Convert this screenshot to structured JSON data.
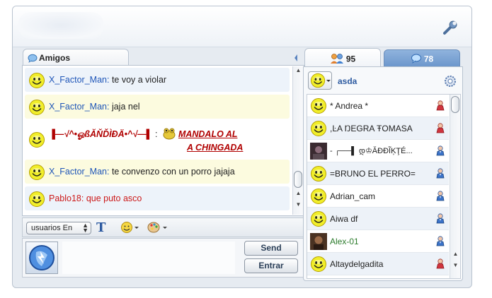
{
  "left": {
    "tab_label": "Amigos",
    "messages": [
      {
        "user": "X_Factor_Man",
        "sep": ": ",
        "text": "te voy a violar"
      },
      {
        "user": "X_Factor_Man",
        "sep": ": ",
        "text": "jaja nel"
      },
      {
        "user": "▐—√^•ஓßĂŇĎÌĐÄ•^√—▌",
        "sep": " : ",
        "text_line1": "MANDALO AL",
        "text_line2": "A CHINGADA"
      },
      {
        "user": "X_Factor_Man",
        "sep": ": ",
        "text": "te convenzo con un porro jajaja"
      },
      {
        "user": "Pablo18",
        "sep": ": ",
        "text": "que puto asco"
      }
    ],
    "toolbar": {
      "users_select": "usuarios En",
      "font_icon": "T"
    },
    "compose": {
      "send_label": "Send",
      "enter_label": "Entrar",
      "input_value": ""
    }
  },
  "right": {
    "users_tab_count": "95",
    "rooms_tab_count": "78",
    "my_name": "asda",
    "users": [
      {
        "name": "* Andrea *",
        "gender": "female"
      },
      {
        "name": ",ĿA ŊEGRA ŦOMASA",
        "gender": "female"
      },
      {
        "name": "-         ┌──▌ დ♔ĂĐĐĨĶŢÉ...",
        "gender": "male"
      },
      {
        "name": "=BRUNO EL PERRO=",
        "gender": "male"
      },
      {
        "name": "Adrian_cam",
        "gender": "male"
      },
      {
        "name": "Aiwa df",
        "gender": "male"
      },
      {
        "name": "Alex-01",
        "gender": "male"
      },
      {
        "name": "Altaydelgadita",
        "gender": "female"
      }
    ]
  },
  "colors": {
    "user_blue": "#1f56b8",
    "user_red": "#cc1a1a",
    "accent_blue": "#6d97cc",
    "female_red": "#d0343e",
    "male_blue": "#3a72c8"
  }
}
